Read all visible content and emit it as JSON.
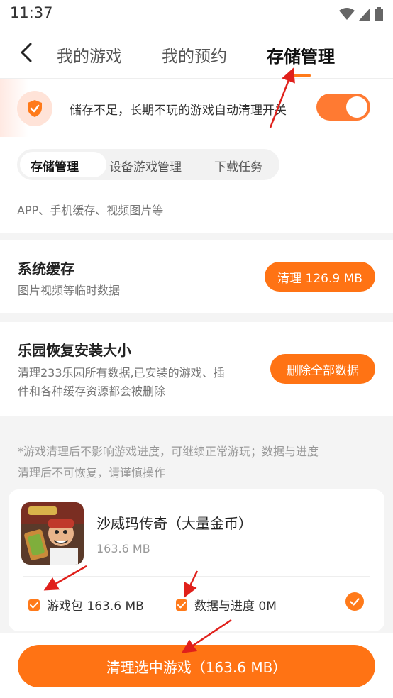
{
  "status_bar": {
    "time": "11:37"
  },
  "nav": {
    "tabs": [
      {
        "label": "我的游戏"
      },
      {
        "label": "我的预约"
      },
      {
        "label": "存储管理"
      }
    ],
    "active_tab": "存储管理"
  },
  "notice": {
    "text": "储存不足，长期不玩的游戏自动清理开关",
    "toggle_on": true
  },
  "segments": {
    "items": [
      {
        "label": "存储管理"
      },
      {
        "label": "设备游戏管理"
      },
      {
        "label": "下载任务"
      }
    ],
    "active": "存储管理"
  },
  "partial_section": {
    "desc": "APP、手机缓存、视频图片等"
  },
  "system_cache": {
    "title": "系统缓存",
    "desc": "图片视频等临时数据",
    "button_label": "清理 126.9 MB"
  },
  "restore": {
    "title": "乐园恢复安装大小",
    "desc_line1": "清理233乐园所有数据,已安装的游戏、插",
    "desc_line2": "件和各种缓存资源都会被删除",
    "button_label": "删除全部数据"
  },
  "note": {
    "line1": "*游戏清理后不影响游戏进度，可继续正常游玩；数据与进度",
    "line2": "清理后不可恢复，请谨慎操作"
  },
  "game": {
    "name": "沙威玛传奇（大量金币）",
    "size": "163.6 MB",
    "options": [
      {
        "label": "游戏包 163.6 MB",
        "checked": true
      },
      {
        "label": "数据与进度 0M",
        "checked": true
      }
    ],
    "selected": true
  },
  "cta": {
    "label": "清理选中游戏（163.6 MB）"
  },
  "colors": {
    "accent": "#ff7314",
    "accent_light": "#ffe3d8",
    "arrow": "#e0201b"
  }
}
